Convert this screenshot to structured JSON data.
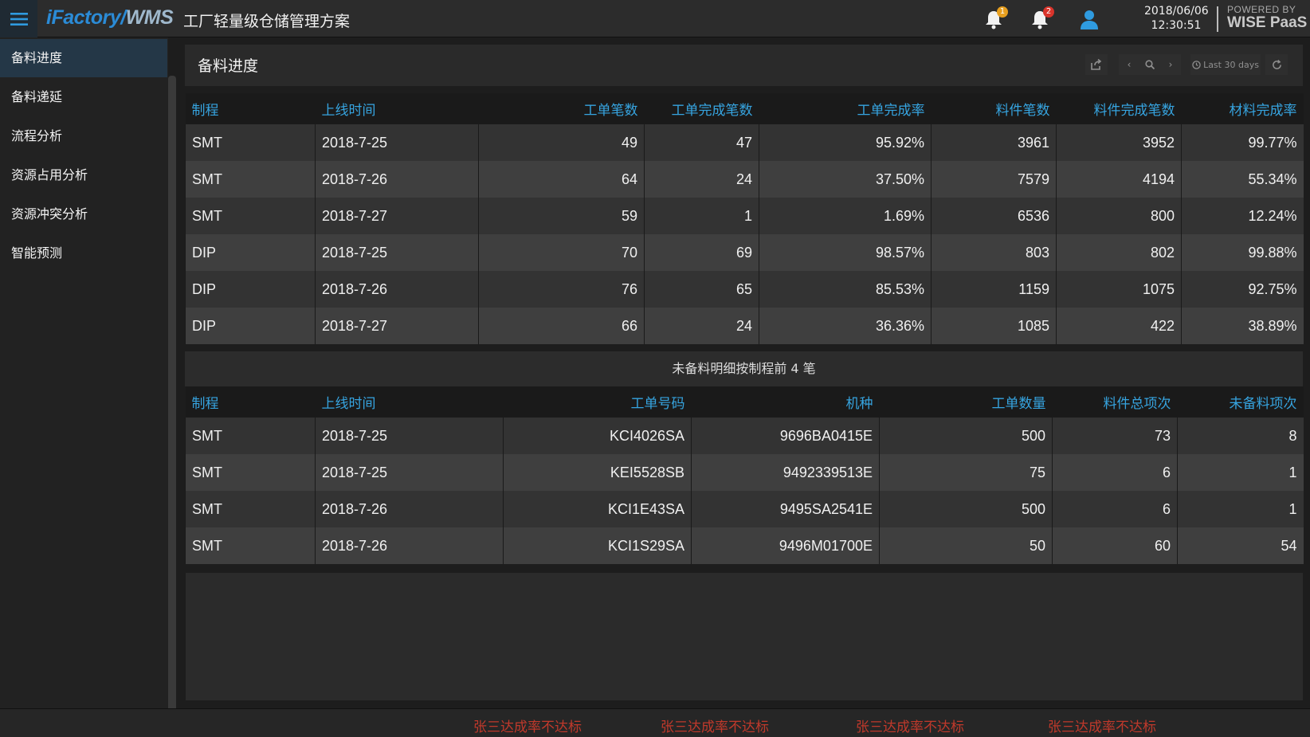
{
  "header": {
    "brand_main": "iFactory/",
    "brand_wms": "WMS",
    "subtitle": "工厂轻量级仓储管理方案",
    "notification_badge_1": "1",
    "notification_badge_2": "2",
    "date": "2018/06/06",
    "time": "12:30:51",
    "powered_by": "POWERED BY",
    "powered_brand": "WISE PaaS"
  },
  "sidebar": {
    "items": [
      {
        "label": "备料进度"
      },
      {
        "label": "备料递延"
      },
      {
        "label": "流程分析"
      },
      {
        "label": "资源占用分析"
      },
      {
        "label": "资源冲突分析"
      },
      {
        "label": "智能预测"
      }
    ]
  },
  "panel": {
    "title": "备料进度",
    "range_label": "Last 30 days"
  },
  "table1": {
    "headers": [
      "制程",
      "上线时间",
      "工单笔数",
      "工单完成笔数",
      "工单完成率",
      "料件笔数",
      "料件完成笔数",
      "材料完成率"
    ],
    "rows": [
      [
        "SMT",
        "2018-7-25",
        "49",
        "47",
        "95.92%",
        "3961",
        "3952",
        "99.77%"
      ],
      [
        "SMT",
        "2018-7-26",
        "64",
        "24",
        "37.50%",
        "7579",
        "4194",
        "55.34%"
      ],
      [
        "SMT",
        "2018-7-27",
        "59",
        "1",
        "1.69%",
        "6536",
        "800",
        "12.24%"
      ],
      [
        "DIP",
        "2018-7-25",
        "70",
        "69",
        "98.57%",
        "803",
        "802",
        "99.88%"
      ],
      [
        "DIP",
        "2018-7-26",
        "76",
        "65",
        "85.53%",
        "1159",
        "1075",
        "92.75%"
      ],
      [
        "DIP",
        "2018-7-27",
        "66",
        "24",
        "36.36%",
        "1085",
        "422",
        "38.89%"
      ]
    ]
  },
  "section2_title": "未备料明细按制程前 4 笔",
  "table2": {
    "headers": [
      "制程",
      "上线时间",
      "工单号码",
      "机种",
      "工单数量",
      "料件总项次",
      "未备料项次"
    ],
    "rows": [
      [
        "SMT",
        "2018-7-25",
        "KCI4026SA",
        "9696BA0415E",
        "500",
        "73",
        "8"
      ],
      [
        "SMT",
        "2018-7-25",
        "KEI5528SB",
        "9492339513E",
        "75",
        "6",
        "1"
      ],
      [
        "SMT",
        "2018-7-26",
        "KCI1E43SA",
        "9495SA2541E",
        "500",
        "6",
        "1"
      ],
      [
        "SMT",
        "2018-7-26",
        "KCI1S29SA",
        "9496M01700E",
        "50",
        "60",
        "54"
      ]
    ]
  },
  "footer": {
    "alerts": [
      "张三达成率不达标",
      "张三达成率不达标",
      "张三达成率不达标",
      "张三达成率不达标"
    ]
  },
  "colors": {
    "accent": "#36a4e0",
    "badge_orange": "#e8a020",
    "badge_red": "#d9342b",
    "alert_red": "#c0392b"
  }
}
